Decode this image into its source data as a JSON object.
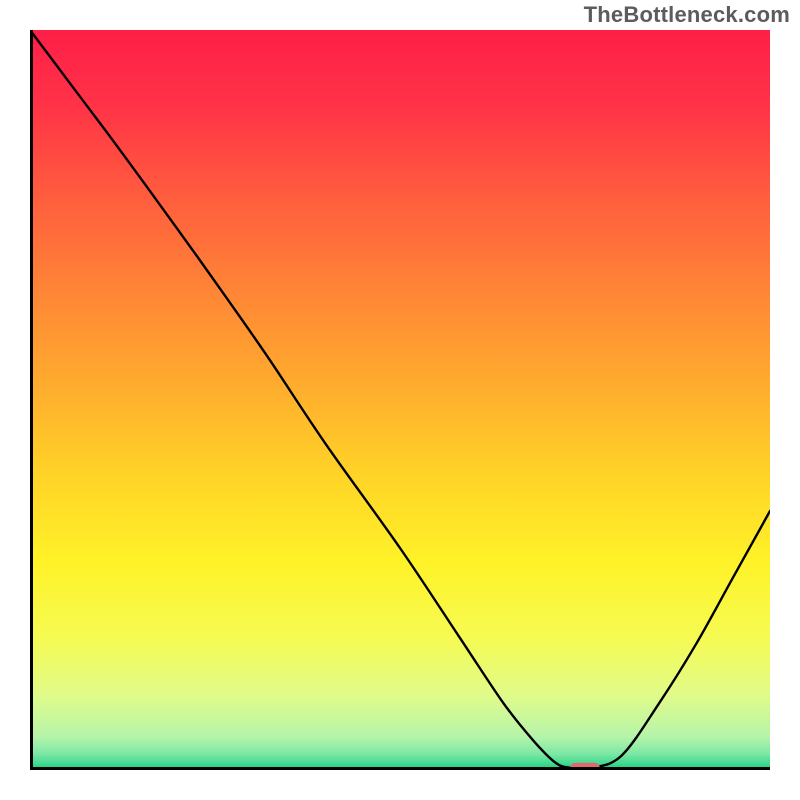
{
  "watermark": "TheBottleneck.com",
  "chart_data": {
    "type": "line",
    "title": "",
    "xlabel": "",
    "ylabel": "",
    "xlim": [
      0,
      100
    ],
    "ylim": [
      0,
      100
    ],
    "grid": false,
    "series": [
      {
        "name": "bottleneck-curve",
        "x": [
          0,
          6,
          12,
          20,
          25,
          32,
          40,
          50,
          58,
          64,
          68,
          71,
          73,
          76,
          80,
          85,
          90,
          95,
          100
        ],
        "y": [
          100,
          92,
          84,
          73,
          66,
          56,
          44,
          30,
          18,
          9,
          4,
          1,
          0.3,
          0.3,
          2,
          9,
          17,
          26,
          35
        ]
      }
    ],
    "marker": {
      "name": "optimal-range",
      "x_start": 73,
      "x_end": 77,
      "y": 0.3,
      "color": "#e06a6b"
    },
    "background_gradient": {
      "stops": [
        {
          "offset": 0.0,
          "color": "#ff1f47"
        },
        {
          "offset": 0.1,
          "color": "#ff3247"
        },
        {
          "offset": 0.22,
          "color": "#ff5b3e"
        },
        {
          "offset": 0.35,
          "color": "#ff8436"
        },
        {
          "offset": 0.48,
          "color": "#ffac2e"
        },
        {
          "offset": 0.6,
          "color": "#ffd327"
        },
        {
          "offset": 0.72,
          "color": "#fff228"
        },
        {
          "offset": 0.82,
          "color": "#f6fb52"
        },
        {
          "offset": 0.9,
          "color": "#e0fb8a"
        },
        {
          "offset": 0.955,
          "color": "#b6f4aa"
        },
        {
          "offset": 0.978,
          "color": "#7de8a5"
        },
        {
          "offset": 0.992,
          "color": "#3dd990"
        },
        {
          "offset": 1.0,
          "color": "#18c87a"
        }
      ]
    },
    "axes_visible": true
  }
}
